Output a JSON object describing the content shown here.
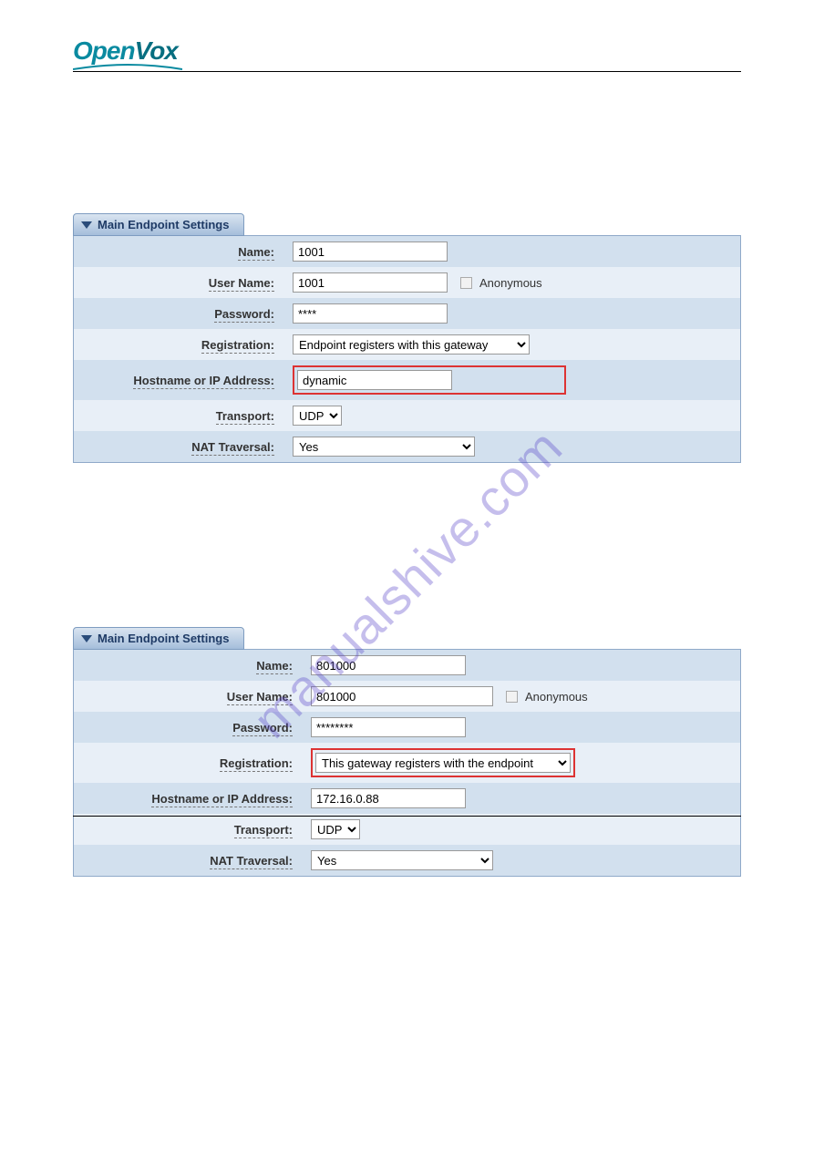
{
  "brand": {
    "part1": "Open",
    "part2": "Vox"
  },
  "watermark": "manualshive.com",
  "panel1": {
    "title": "Main Endpoint Settings",
    "fields": {
      "name_label": "Name:",
      "name_value": "1001",
      "username_label": "User Name:",
      "username_value": "1001",
      "anonymous_label": "Anonymous",
      "password_label": "Password:",
      "password_value": "****",
      "registration_label": "Registration:",
      "registration_value": "Endpoint registers with this gateway",
      "hostname_label": "Hostname or IP Address:",
      "hostname_value": "dynamic",
      "transport_label": "Transport:",
      "transport_value": "UDP",
      "nat_label": "NAT Traversal:",
      "nat_value": "Yes"
    }
  },
  "panel2": {
    "title": "Main Endpoint Settings",
    "fields": {
      "name_label": "Name:",
      "name_value": "801000",
      "username_label": "User Name:",
      "username_value": "801000",
      "anonymous_label": "Anonymous",
      "password_label": "Password:",
      "password_value": "********",
      "registration_label": "Registration:",
      "registration_value": "This gateway registers with the endpoint",
      "hostname_label": "Hostname or IP Address:",
      "hostname_value": "172.16.0.88",
      "transport_label": "Transport:",
      "transport_value": "UDP",
      "nat_label": "NAT Traversal:",
      "nat_value": "Yes"
    }
  }
}
